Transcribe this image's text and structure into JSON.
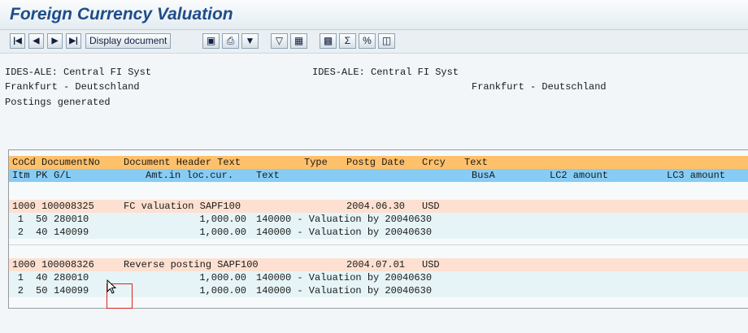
{
  "window": {
    "title": "Foreign Currency Valuation"
  },
  "toolbar": {
    "first": "|◀",
    "prev": "◀",
    "next": "▶",
    "last": "▶|",
    "display_document": "Display document",
    "icons": [
      "detail-icon",
      "print-icon",
      "filter-icon",
      "set-filter-icon",
      "export-icon",
      "layout-icon",
      "sum-icon",
      "subtotal-icon",
      "view-icon"
    ]
  },
  "header": {
    "left1": "IDES-ALE: Central FI Syst",
    "left2": "Frankfurt - Deutschland",
    "center1": "IDES-ALE: Central FI Syst",
    "right2": "Frankfurt - Deutschland",
    "status": "Postings generated"
  },
  "columns": {
    "line1": [
      "CoCd",
      "DocumentNo",
      "Document Header Text",
      "Type",
      "Postg Date",
      "Crcy",
      "Text"
    ],
    "line2": [
      "Itm",
      "PK",
      "G/L",
      "Amt.in loc.cur.",
      "Text",
      "BusA",
      "LC2 amount",
      "LC3 amount"
    ]
  },
  "documents": [
    {
      "cocd": "1000",
      "docno": "100008325",
      "header_text": "FC valuation SAPF100",
      "date": "2004.06.30",
      "crcy": "USD",
      "items": [
        {
          "itm": "1",
          "pk": "50",
          "gl": "280010",
          "amount": "1,000.00",
          "text": "140000 - Valuation by 20040630"
        },
        {
          "itm": "2",
          "pk": "40",
          "gl": "140099",
          "amount": "1,000.00",
          "text": "140000 - Valuation by 20040630"
        }
      ]
    },
    {
      "cocd": "1000",
      "docno": "100008326",
      "header_text": "Reverse posting SAPF100",
      "date": "2004.07.01",
      "crcy": "USD",
      "items": [
        {
          "itm": "1",
          "pk": "40",
          "gl": "280010",
          "amount": "1,000.00",
          "text": "140000 - Valuation by 20040630"
        },
        {
          "itm": "2",
          "pk": "50",
          "gl": "140099",
          "amount": "1,000.00",
          "text": "140000 - Valuation by 20040630"
        }
      ]
    }
  ],
  "colors": {
    "title": "#1f4c8a",
    "header_row1": "#ffc06a",
    "header_row2": "#86ccf5",
    "doc_row": "#fde0d1",
    "item_row": "#e6f4f7",
    "highlight": "#e02020"
  }
}
